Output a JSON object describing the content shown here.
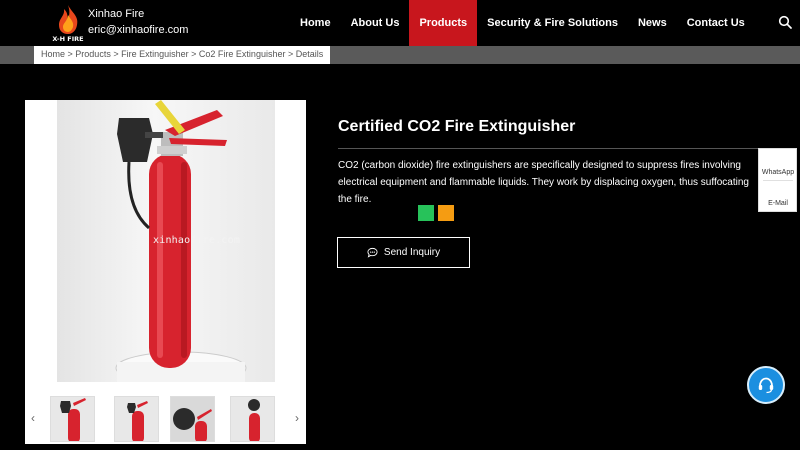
{
  "brand": {
    "name": "Xinhao Fire",
    "email": "eric@xinhaofire.com",
    "logo_text": "X-H FIRE"
  },
  "nav": {
    "items": [
      {
        "label": "Home"
      },
      {
        "label": "About Us"
      },
      {
        "label": "Products"
      },
      {
        "label": "Security & Fire Solutions"
      },
      {
        "label": "News"
      },
      {
        "label": "Contact Us"
      }
    ],
    "active": "Products"
  },
  "breadcrumb": {
    "items": [
      "Home",
      "Products",
      "Fire Extinguisher",
      "Co2 Fire Extinguisher"
    ],
    "current": "Details",
    "separator": ">"
  },
  "gallery": {
    "watermark": "xinhaofire.com",
    "prev_arrow": "‹",
    "next_arrow": "›"
  },
  "product": {
    "title": "Certified CO2 Fire Extinguisher",
    "description": "CO2 (carbon dioxide) fire extinguishers are specifically designed to suppress fires involving electrical equipment and flammable liquids. They work by displacing oxygen, thus suffocating the fire.",
    "inquiry_label": "Send Inquiry"
  },
  "side_panel": {
    "whatsapp_label": "WhatsApp",
    "email_label": "E-Mail"
  },
  "colors": {
    "accent": "#c8161d",
    "share_green": "#27c25a",
    "share_orange": "#f59c12",
    "chat_blue": "#1b8fe0"
  },
  "icons": {
    "search": "search-icon",
    "inquiry": "chat-icon",
    "chat_bubble": "headset-icon"
  }
}
